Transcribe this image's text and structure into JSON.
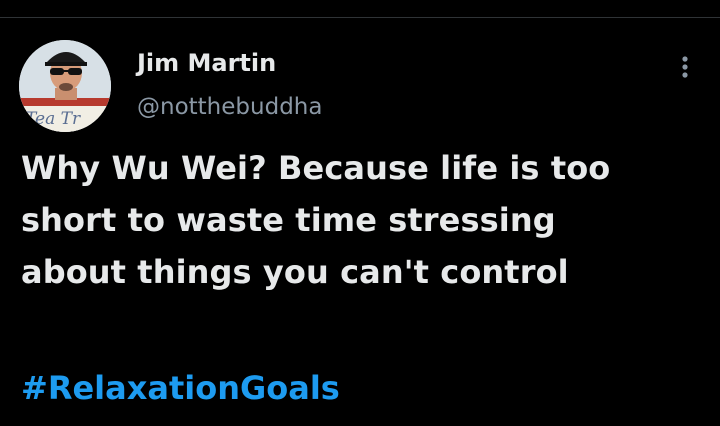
{
  "author": {
    "name": "Jim Martin",
    "handle": "@notthebuddha",
    "avatar_icon": "profile-photo-man-sunglasses-cap",
    "avatar_sign_text": "Tea Tr"
  },
  "menu": {
    "icon": "more-vertical-icon"
  },
  "tweet": {
    "lines": [
      "Why Wu Wei? Because life is too",
      "short to waste time stressing",
      "about things you can't control"
    ],
    "hashtag": "#RelaxationGoals"
  },
  "colors": {
    "background": "#000000",
    "primary_text": "#e7e9ea",
    "secondary_text": "#8b98a5",
    "link": "#1d9bf0"
  }
}
